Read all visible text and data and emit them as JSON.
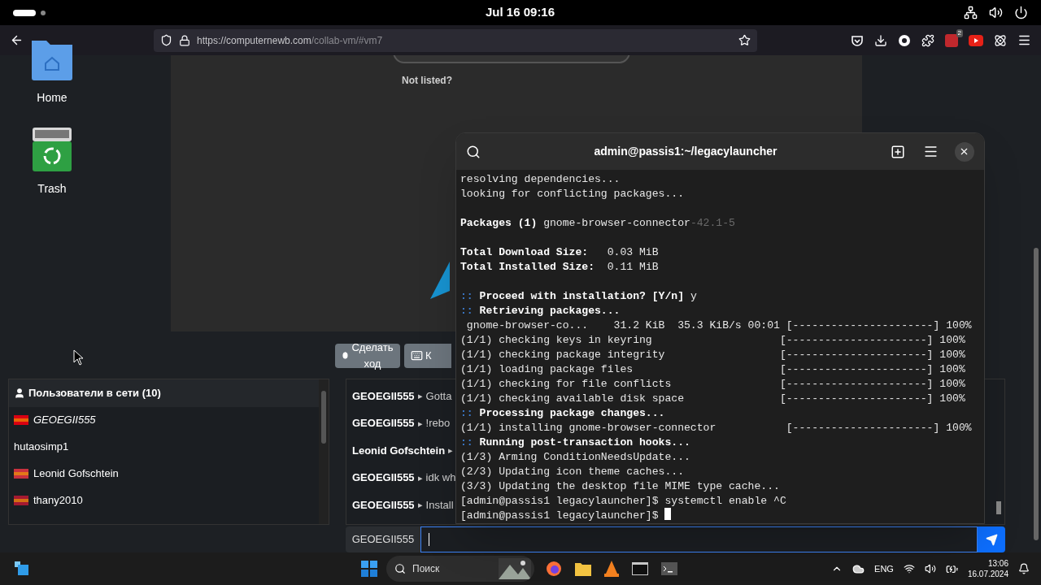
{
  "top_bar": {
    "clock": "Jul 16  09:16"
  },
  "browser": {
    "url_host": "https://computernewb.com",
    "url_path": "/collab-vm/#vm7",
    "extension_badge": "2"
  },
  "desktop_icons": [
    {
      "kind": "home",
      "label": "Home"
    },
    {
      "kind": "trash",
      "label": "Trash"
    }
  ],
  "vm_screen": {
    "link": "Not listed?"
  },
  "vm_buttons": [
    {
      "kind": "mouse",
      "label": "Сделать ход"
    },
    {
      "kind": "keyboard",
      "label": "К"
    }
  ],
  "users_panel": {
    "title": "Пользователи в сети (10)",
    "users": [
      {
        "name": "GEOEGII555",
        "current_user": true,
        "kind": "flag",
        "color": "#d90012"
      },
      {
        "name": "hutaosimp1",
        "current_user": false,
        "kind": "plain"
      },
      {
        "name": "Leonid Gofschtein",
        "current_user": false,
        "kind": "flag",
        "color": "#c8313e"
      },
      {
        "name": "thany2010",
        "current_user": false,
        "kind": "flag",
        "color": "#a51931"
      }
    ]
  },
  "chat": {
    "messages": [
      {
        "user": "GEOEGII555",
        "separator": "▸",
        "text": "Gotta"
      },
      {
        "user": "GEOEGII555",
        "separator": "▸",
        "text": "!rebo"
      },
      {
        "user": "Leonid Gofschtein",
        "separator": "▸"
      },
      {
        "user": "GEOEGII555",
        "separator": "▸",
        "text": "idk wh"
      },
      {
        "user": "GEOEGII555",
        "separator": "▸",
        "text": "Install"
      }
    ],
    "username": "GEOEGII555"
  },
  "terminal": {
    "title": "admin@passis1:~/legacylauncher",
    "lines": [
      {
        "kind": "text",
        "segments": [
          {
            "kind": "normal",
            "text": "resolving dependencies..."
          }
        ]
      },
      {
        "kind": "text",
        "segments": [
          {
            "kind": "normal",
            "text": "looking for conflicting packages..."
          }
        ]
      },
      {
        "kind": "blank"
      },
      {
        "kind": "text",
        "segments": [
          {
            "kind": "bold",
            "text": "Packages (1)"
          },
          {
            "kind": "normal",
            "text": " gnome-browser-connector"
          },
          {
            "kind": "dim",
            "text": "-42.1-5"
          }
        ]
      },
      {
        "kind": "blank"
      },
      {
        "kind": "text",
        "segments": [
          {
            "kind": "bold",
            "text": "Total Download Size:"
          },
          {
            "kind": "normal",
            "text": "   0.03 MiB"
          }
        ]
      },
      {
        "kind": "text",
        "segments": [
          {
            "kind": "bold",
            "text": "Total Installed Size:"
          },
          {
            "kind": "normal",
            "text": "  0.11 MiB"
          }
        ]
      },
      {
        "kind": "blank"
      },
      {
        "kind": "text",
        "segments": [
          {
            "kind": "accent",
            "text": "::"
          },
          {
            "kind": "bold",
            "text": " Proceed with installation? [Y/n]"
          },
          {
            "kind": "normal",
            "text": " y"
          }
        ]
      },
      {
        "kind": "text",
        "segments": [
          {
            "kind": "accent",
            "text": "::"
          },
          {
            "kind": "bold",
            "text": " Retrieving packages..."
          }
        ]
      },
      {
        "kind": "text",
        "segments": [
          {
            "kind": "normal",
            "text": " gnome-browser-co...    31.2 KiB  35.3 KiB/s 00:01 [----------------------] 100%"
          }
        ]
      },
      {
        "kind": "text",
        "segments": [
          {
            "kind": "normal",
            "text": "(1/1) checking keys in keyring                    [----------------------] 100%"
          }
        ]
      },
      {
        "kind": "text",
        "segments": [
          {
            "kind": "normal",
            "text": "(1/1) checking package integrity                  [----------------------] 100%"
          }
        ]
      },
      {
        "kind": "text",
        "segments": [
          {
            "kind": "normal",
            "text": "(1/1) loading package files                       [----------------------] 100%"
          }
        ]
      },
      {
        "kind": "text",
        "segments": [
          {
            "kind": "normal",
            "text": "(1/1) checking for file conflicts                 [----------------------] 100%"
          }
        ]
      },
      {
        "kind": "text",
        "segments": [
          {
            "kind": "normal",
            "text": "(1/1) checking available disk space               [----------------------] 100%"
          }
        ]
      },
      {
        "kind": "text",
        "segments": [
          {
            "kind": "accent",
            "text": "::"
          },
          {
            "kind": "bold",
            "text": " Processing package changes..."
          }
        ]
      },
      {
        "kind": "text",
        "segments": [
          {
            "kind": "normal",
            "text": "(1/1) installing gnome-browser-connector           [----------------------] 100%"
          }
        ]
      },
      {
        "kind": "text",
        "segments": [
          {
            "kind": "accent",
            "text": "::"
          },
          {
            "kind": "bold",
            "text": " Running post-transaction hooks..."
          }
        ]
      },
      {
        "kind": "text",
        "segments": [
          {
            "kind": "normal",
            "text": "(1/3) Arming ConditionNeedsUpdate..."
          }
        ]
      },
      {
        "kind": "text",
        "segments": [
          {
            "kind": "normal",
            "text": "(2/3) Updating icon theme caches..."
          }
        ]
      },
      {
        "kind": "text",
        "segments": [
          {
            "kind": "normal",
            "text": "(3/3) Updating the desktop file MIME type cache..."
          }
        ]
      },
      {
        "kind": "text",
        "segments": [
          {
            "kind": "normal",
            "text": "[admin@passis1 legacylauncher]$ systemctl enable ^C"
          }
        ]
      },
      {
        "kind": "input",
        "segments": [
          {
            "kind": "normal",
            "text": "[admin@passis1 legacylauncher]$ "
          }
        ]
      }
    ]
  },
  "taskbar": {
    "search_placeholder": "Поиск",
    "language": "ENG",
    "time": "13:06",
    "date": "16.07.2024"
  }
}
